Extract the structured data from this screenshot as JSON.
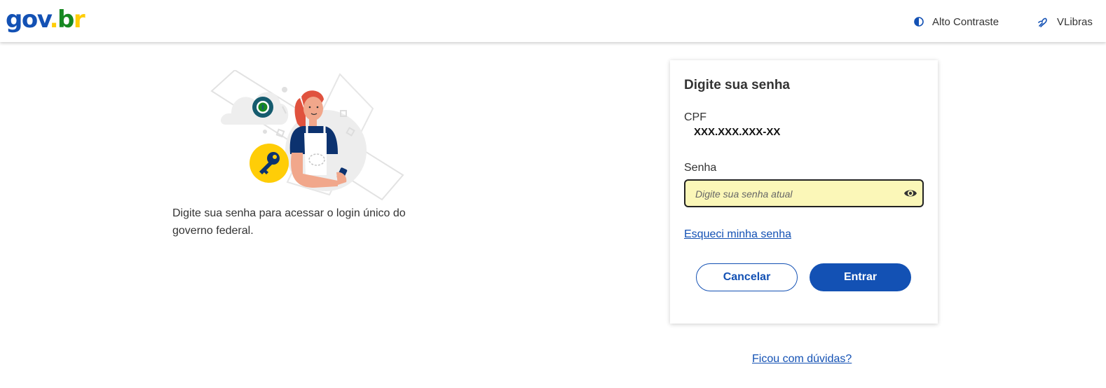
{
  "header": {
    "logo": {
      "g": "g",
      "o": "o",
      "v": "v",
      "dot": ".",
      "b": "b",
      "r": "r"
    },
    "contrast_label": "Alto Contraste",
    "vlibras_label": "VLibras"
  },
  "intro": {
    "text": "Digite sua senha para acessar o login único do governo federal."
  },
  "card": {
    "title": "Digite sua senha",
    "cpf_label": "CPF",
    "cpf_value": "XXX.XXX.XXX-XX",
    "password_label": "Senha",
    "password_placeholder": "Digite sua senha atual",
    "password_value": "",
    "forgot_link": "Esqueci minha senha",
    "cancel_label": "Cancelar",
    "enter_label": "Entrar"
  },
  "footer": {
    "help_link": "Ficou com dúvidas?"
  },
  "icons": {
    "contrast": "contrast-icon",
    "vlibras": "vlibras-hand-icon",
    "eye": "eye-icon",
    "key": "key-icon",
    "lock": "lock-icon"
  },
  "colors": {
    "primary": "#1351b4",
    "input_highlight": "#fbf7b8",
    "key_badge": "#ffcd07"
  }
}
